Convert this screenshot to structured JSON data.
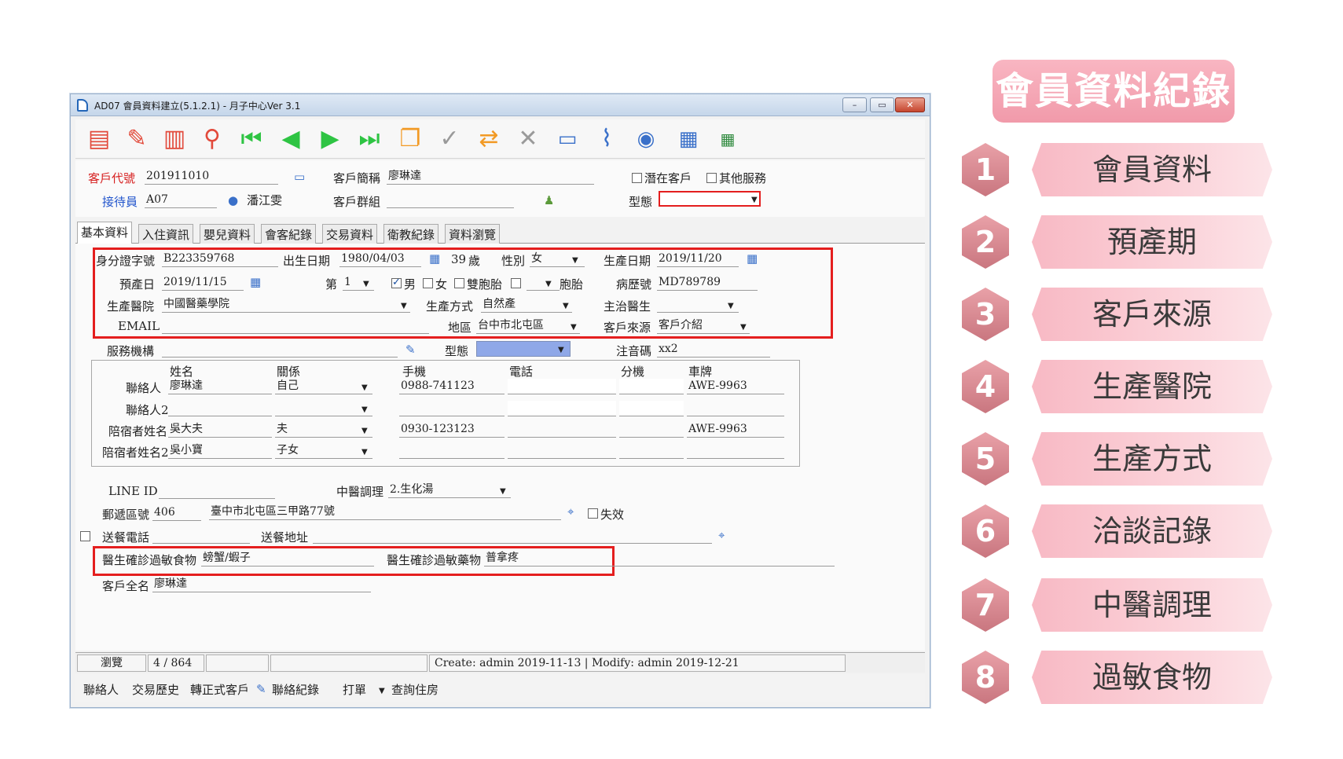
{
  "window": {
    "title": "AD07 會員資料建立(5.1.2.1) - 月子中心Ver 3.1",
    "min": "–",
    "max": "▭",
    "close": "✕"
  },
  "toolbar": {
    "icons": [
      "new-document-icon",
      "edit-pencil-icon",
      "delete-trash-icon",
      "search-magnifier-icon",
      "first-record-icon",
      "previous-record-icon",
      "next-record-icon",
      "last-record-icon",
      "copy-icon",
      "confirm-check-icon",
      "refresh-icon",
      "cancel-x-icon",
      "book-icon",
      "attach-icon",
      "view-eye-icon",
      "export-xls-icon",
      "grid-icon"
    ]
  },
  "header": {
    "customer_code_label": "客戶代號",
    "customer_code": "201911010",
    "customer_short_label": "客戶簡稱",
    "customer_short": "廖琳達",
    "potential_label": "潛在客戶",
    "other_service_label": "其他服務",
    "receptionist_label": "接待員",
    "receptionist_code": "A07",
    "receptionist_name": "潘江雯",
    "customer_group_label": "客戶群組",
    "customer_group": "",
    "type_label": "型態",
    "type_value": ""
  },
  "tabs": [
    "基本資料",
    "入住資訊",
    "嬰兒資料",
    "會客紀錄",
    "交易資料",
    "衛教紀錄",
    "資料瀏覽"
  ],
  "basic": {
    "id_label": "身分證字號",
    "id": "B223359768",
    "birth_label": "出生日期",
    "birth": "1980/04/03",
    "age": "39",
    "age_unit": "歲",
    "gender_label": "性別",
    "gender": "女",
    "delivery_date_label": "生產日期",
    "delivery_date": "2019/11/20",
    "due_label": "預產日",
    "due": "2019/11/15",
    "nth_label": "第",
    "nth": "1",
    "male_label": "男",
    "female_label": "女",
    "twins_label": "雙胞胎",
    "fetus_label": "胞胎",
    "record_no_label": "病歷號",
    "record_no": "MD789789",
    "hospital_label": "生產醫院",
    "hospital": "中國醫藥學院",
    "method_label": "生產方式",
    "method": "自然產",
    "doctor_label": "主治醫生",
    "doctor": "",
    "email_label": "EMAIL",
    "email": "",
    "region_label": "地區",
    "region": "台中市北屯區",
    "source_label": "客戶來源",
    "source": "客戶介紹",
    "service_label": "服務機構",
    "service": "",
    "type2_label": "型態",
    "phonetic_label": "注音碼",
    "phonetic": "xx2"
  },
  "contacts": {
    "headers": {
      "name": "姓名",
      "relation": "關係",
      "mobile": "手機",
      "phone": "電話",
      "ext": "分機",
      "plate": "車牌"
    },
    "rows": [
      {
        "label": "聯絡人",
        "name": "廖琳達",
        "relation": "自己",
        "mobile": "0988-741123",
        "phone": "",
        "ext": "",
        "plate": "AWE-9963"
      },
      {
        "label": "聯絡人2",
        "name": "",
        "relation": "",
        "mobile": "",
        "phone": "",
        "ext": "",
        "plate": ""
      },
      {
        "label": "陪宿者姓名",
        "name": "吳大夫",
        "relation": "夫",
        "mobile": "0930-123123",
        "phone": "",
        "ext": "",
        "plate": "AWE-9963"
      },
      {
        "label": "陪宿者姓名2",
        "name": "吳小寶",
        "relation": "子女",
        "mobile": "",
        "phone": "",
        "ext": "",
        "plate": ""
      }
    ]
  },
  "extra": {
    "line_label": "LINE ID",
    "line": "",
    "tcm_label": "中醫調理",
    "tcm": "2.生化湯",
    "zip_label": "郵遞區號",
    "zip": "406",
    "address": "臺中市北屯區三甲路77號",
    "invalid_label": "失效",
    "meal_phone_label": "送餐電話",
    "meal_phone": "",
    "meal_addr_label": "送餐地址",
    "meal_addr": "",
    "food_allergy_label": "醫生確診過敏食物",
    "food_allergy": "螃蟹/蝦子",
    "drug_allergy_label": "醫生確診過敏藥物",
    "drug_allergy": "普拿疼",
    "full_name_label": "客戶全名",
    "full_name": "廖琳達"
  },
  "status": {
    "mode": "瀏覽",
    "record": "4 / 864",
    "audit": "Create: admin 2019-11-13 | Modify: admin 2019-12-21"
  },
  "bottom": [
    "聯絡人",
    "交易歷史",
    "轉正式客戶",
    "聯絡紀錄",
    "打單",
    "查詢住房"
  ],
  "legend": {
    "title": "會員資料紀錄",
    "items": [
      {
        "num": "1",
        "label": "會員資料"
      },
      {
        "num": "2",
        "label": "預產期"
      },
      {
        "num": "3",
        "label": "客戶來源"
      },
      {
        "num": "4",
        "label": "生產醫院"
      },
      {
        "num": "5",
        "label": "生產方式"
      },
      {
        "num": "6",
        "label": "洽談記錄"
      },
      {
        "num": "7",
        "label": "中醫調理"
      },
      {
        "num": "8",
        "label": "過敏食物"
      }
    ]
  },
  "colors": {
    "highlight": "#e41e1e",
    "legend_pink": "#f19aaa",
    "hex_pink": "#c9767f",
    "label_red": "#d62020",
    "label_blue": "#2255cc"
  }
}
